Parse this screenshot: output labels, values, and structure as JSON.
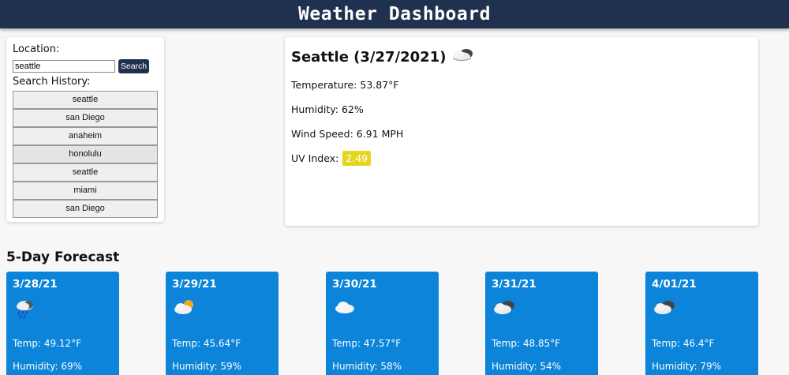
{
  "header": {
    "title": "Weather Dashboard"
  },
  "search": {
    "location_label": "Location:",
    "value": "seattle",
    "button_label": "Search",
    "history_label": "Search History:",
    "history": [
      "seattle",
      "san Diego",
      "anaheim",
      "honolulu",
      "seattle",
      "miami",
      "san Diego"
    ]
  },
  "current": {
    "title": "Seattle (3/27/2021)",
    "icon": "cloud-icon",
    "temperature": "Temperature: 53.87°F",
    "humidity": "Humidity: 62%",
    "wind": "Wind Speed: 6.91 MPH",
    "uv_label": "UV Index:",
    "uv_value": "2.49",
    "uv_color": "#e6d61b"
  },
  "forecast": {
    "title": "5-Day Forecast",
    "cards": [
      {
        "date": "3/28/21",
        "icon": "rain-cloud-icon",
        "temp": "Temp: 49.12°F",
        "humidity": "Humidity: 69%"
      },
      {
        "date": "3/29/21",
        "icon": "sun-cloud-icon",
        "temp": "Temp: 45.64°F",
        "humidity": "Humidity: 59%"
      },
      {
        "date": "3/30/21",
        "icon": "cloud-icon",
        "temp": "Temp: 47.57°F",
        "humidity": "Humidity: 58%"
      },
      {
        "date": "3/31/21",
        "icon": "clouds-icon",
        "temp": "Temp: 48.85°F",
        "humidity": "Humidity: 54%"
      },
      {
        "date": "4/01/21",
        "icon": "clouds-icon",
        "temp": "Temp: 46.4°F",
        "humidity": "Humidity: 79%"
      }
    ]
  },
  "colors": {
    "header": "#20304f",
    "card": "#0b84d9",
    "uv": "#e6d61b"
  }
}
